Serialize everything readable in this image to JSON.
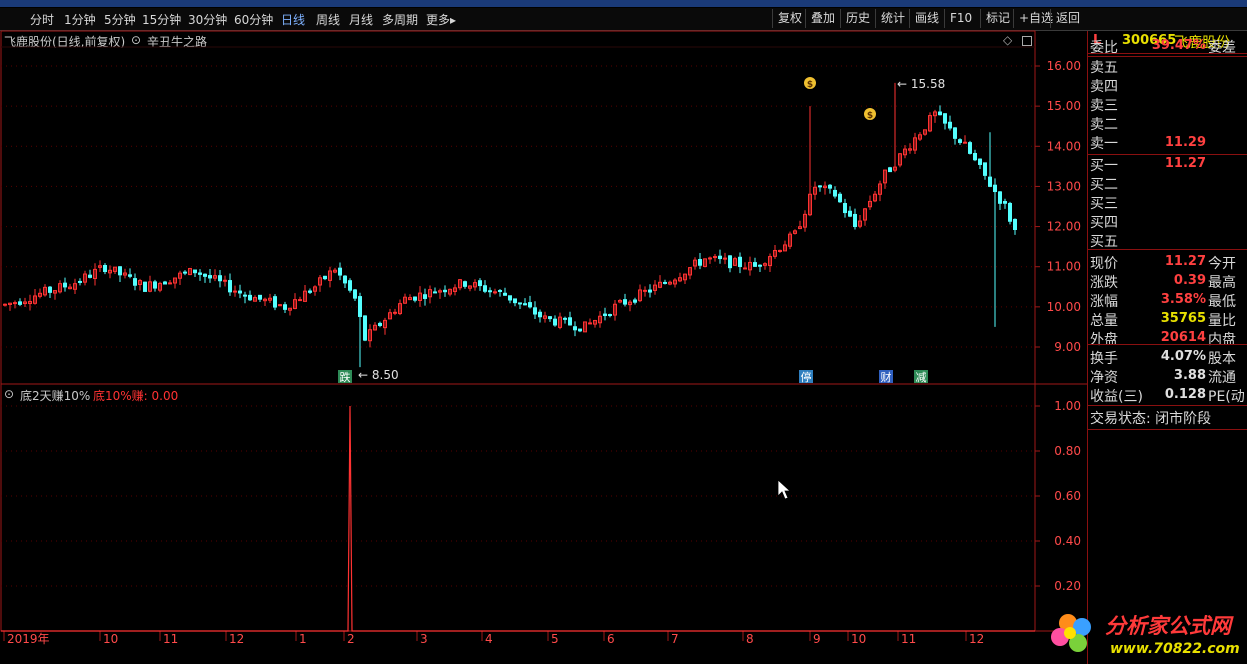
{
  "toolbar": {
    "periods": [
      "分时",
      "1分钟",
      "5分钟",
      "15分钟",
      "30分钟",
      "60分钟",
      "日线",
      "周线",
      "月线",
      "多周期",
      "更多▸"
    ],
    "selected_period": "日线",
    "right_buttons": [
      "复权",
      "叠加",
      "历史",
      "统计",
      "画线",
      "F10",
      "标记",
      "+自选",
      "返回"
    ]
  },
  "main_chart": {
    "title": "飞鹿股份(日线,前复权)",
    "indicator": "辛丑牛之路",
    "price_ticks": [
      "16.00",
      "15.00",
      "14.00",
      "13.00",
      "12.00",
      "11.00",
      "10.00",
      "9.00"
    ],
    "max_label": "15.58",
    "min_label": "8.50",
    "markers": [
      {
        "label": "跌",
        "color": "#2e8b57"
      },
      {
        "label": "停",
        "color": "#2f7fbf"
      },
      {
        "label": "财",
        "color": "#2f5fbf"
      },
      {
        "label": "减",
        "color": "#2e8b57"
      }
    ]
  },
  "sub_chart": {
    "title": "底2天赚10%",
    "value_label": "底10%赚: 0.00",
    "ticks": [
      "1.00",
      "0.80",
      "0.60",
      "0.40",
      "0.20"
    ]
  },
  "x_axis": {
    "labels": [
      "2019年",
      "10",
      "11",
      "12",
      "1",
      "2",
      "3",
      "4",
      "5",
      "6",
      "7",
      "8",
      "9",
      "10",
      "11",
      "12"
    ]
  },
  "quote_panel": {
    "flag": "L",
    "code": "300665",
    "name": "飞鹿股份",
    "weibi_label": "委比",
    "weibi_value": "39.47%",
    "weicha_label": "委差",
    "sell_labels": [
      "卖五",
      "卖四",
      "卖三",
      "卖二",
      "卖一"
    ],
    "sell1_price": "11.29",
    "buy_labels": [
      "买一",
      "买二",
      "买三",
      "买四",
      "买五"
    ],
    "buy1_price": "11.27",
    "rows": [
      {
        "l": "现价",
        "v": "11.27",
        "r": "今开",
        "c": "#ff4040"
      },
      {
        "l": "涨跌",
        "v": "0.39",
        "r": "最高",
        "c": "#ff4040"
      },
      {
        "l": "涨幅",
        "v": "3.58%",
        "r": "最低",
        "c": "#ff4040"
      },
      {
        "l": "总量",
        "v": "35765",
        "r": "量比",
        "c": "#e8e000"
      },
      {
        "l": "外盘",
        "v": "20614",
        "r": "内盘",
        "c": "#ff4040"
      }
    ],
    "rows2": [
      {
        "l": "换手",
        "v": "4.07%",
        "r": "股本"
      },
      {
        "l": "净资",
        "v": "3.88",
        "r": "流通"
      },
      {
        "l": "收益(三)",
        "v": "0.128",
        "r": "PE(动"
      }
    ],
    "trade_status": "交易状态: 闭市阶段"
  },
  "watermark": {
    "text": "分析家公式网",
    "url": "www.70822.com"
  },
  "colors": {
    "up": "#ff3232",
    "down": "#54ffff",
    "axis": "#a01818",
    "accent": "#ff4040",
    "yellow": "#e8e000"
  }
}
